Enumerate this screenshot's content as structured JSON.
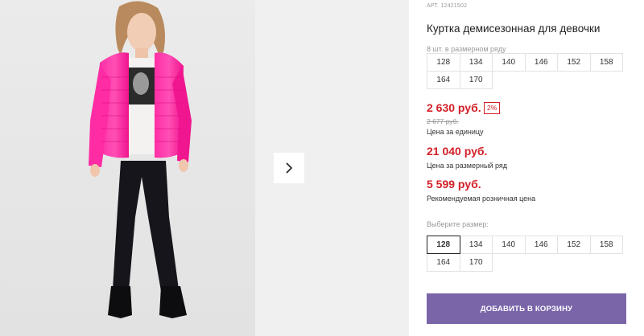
{
  "product": {
    "article": "АРТ. 12421502",
    "title": "Куртка демисезонная для девочки"
  },
  "pack": {
    "label": "8 шт. в размерном ряду",
    "rows": [
      [
        "128",
        "134",
        "140",
        "146",
        "152",
        "158"
      ],
      [
        "164",
        "170"
      ]
    ]
  },
  "prices": {
    "unit_price": "2 630 руб.",
    "discount": "2%",
    "old_price": "2 677 руб.",
    "unit_caption": "Цена за единицу",
    "row_price": "21 040 руб.",
    "row_caption": "Цена за размерный ряд",
    "retail_price": "5 599 руб.",
    "retail_caption": "Рекомендуемая розничная цена"
  },
  "size_select": {
    "label": "Выберите размер:",
    "selected": "128",
    "rows": [
      [
        "128",
        "134",
        "140",
        "146",
        "152",
        "158"
      ],
      [
        "164",
        "170"
      ]
    ]
  },
  "cart": {
    "button_label": "ДОБАВИТЬ В КОРЗИНУ"
  },
  "colors": {
    "price_red": "#d32027",
    "button_purple": "#7a65a9",
    "jacket_pink": "#ff1e9b"
  },
  "icons": {
    "next": "chevron-right-icon"
  }
}
